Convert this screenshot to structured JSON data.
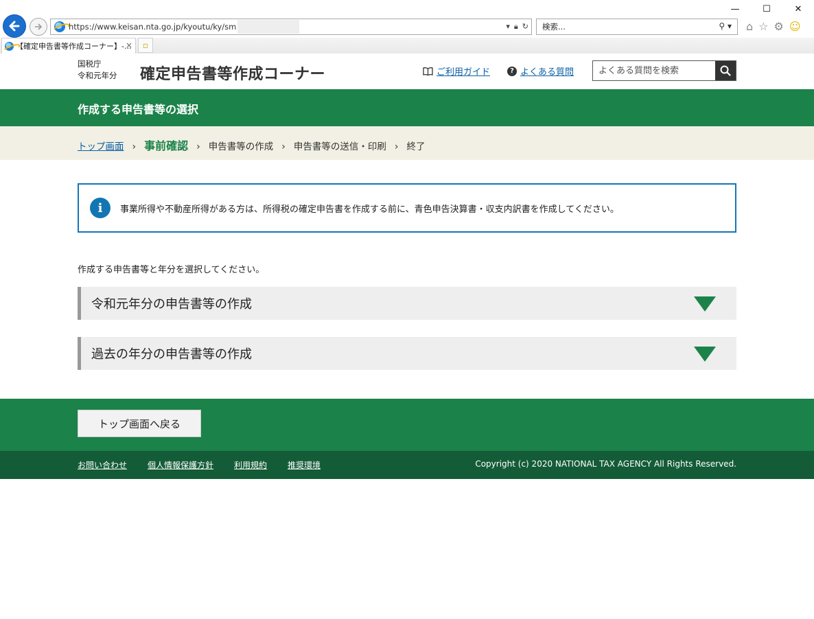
{
  "browser": {
    "url": "https://www.keisan.nta.go.jp/kyoutu/ky/sm",
    "search_placeholder": "検索...",
    "tab_title": "【確定申告書等作成コーナー】-...",
    "tab_close": "×",
    "win_minimize": "—",
    "win_maximize": "☐",
    "win_close": "✕"
  },
  "header": {
    "agency_line1": "国税庁",
    "agency_line2": "令和元年分",
    "site_title": "確定申告書等作成コーナー",
    "guide_link": "ご利用ガイド",
    "faq_link": "よくある質問",
    "faq_search_placeholder": "よくある質問を検索"
  },
  "page": {
    "title": "作成する申告書等の選択"
  },
  "breadcrumb": {
    "items": [
      {
        "label": "トップ画面"
      },
      {
        "label": "事前確認"
      },
      {
        "label": "申告書等の作成"
      },
      {
        "label": "申告書等の送信・印刷"
      },
      {
        "label": "終了"
      }
    ],
    "separator": "›"
  },
  "notice": {
    "icon_glyph": "i",
    "text": "事業所得や不動産所得がある方は、所得税の確定申告書を作成する前に、青色申告決算書・収支内訳書を作成してください。"
  },
  "selection": {
    "instruction": "作成する申告書等と年分を選択してください。",
    "options": [
      {
        "label": "令和元年分の申告書等の作成"
      },
      {
        "label": "過去の年分の申告書等の作成"
      }
    ]
  },
  "footer": {
    "back_button": "トップ画面へ戻る",
    "links": [
      {
        "label": "お問い合わせ"
      },
      {
        "label": "個人情報保護方針"
      },
      {
        "label": "利用規約"
      },
      {
        "label": "推奨環境"
      }
    ],
    "copyright": "Copyright (c) 2020 NATIONAL TAX AGENCY All Rights Reserved."
  },
  "colors": {
    "brand_green": "#1b824a",
    "footer_dark_green": "#145c38",
    "info_blue": "#1376b3",
    "breadcrumb_bg": "#f2f0e4"
  }
}
